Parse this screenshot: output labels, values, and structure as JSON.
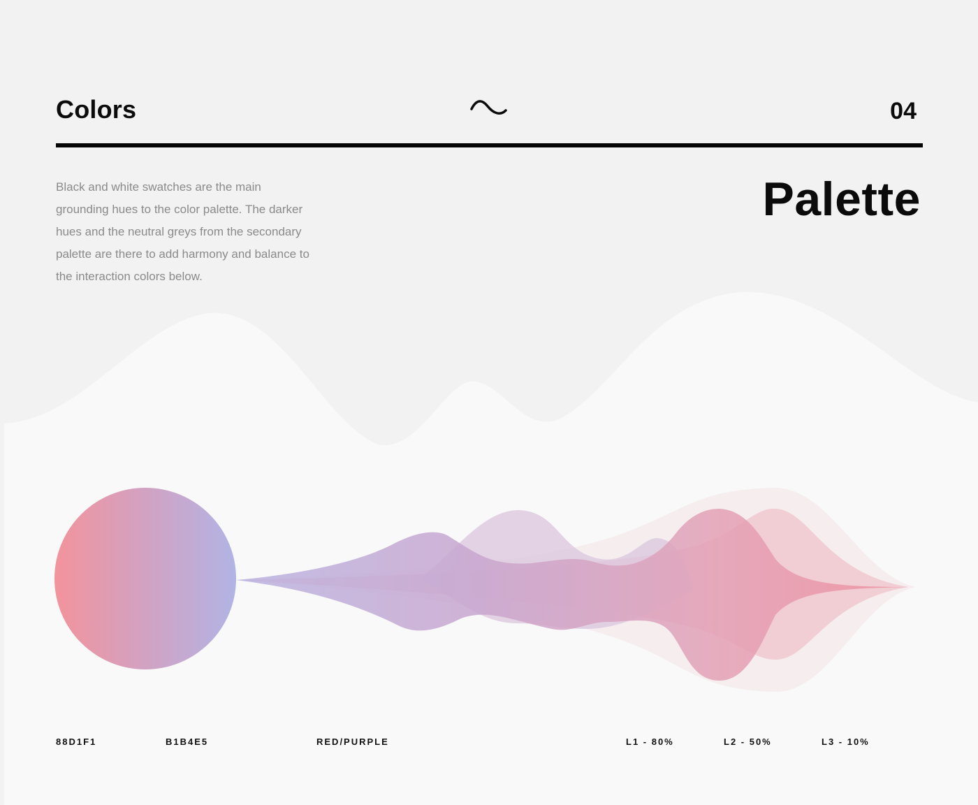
{
  "header": {
    "title": "Colors",
    "page_number": "04",
    "icon": "tilde-wave-icon"
  },
  "section": {
    "title": "Palette",
    "description": "Black and white swatches are the main grounding hues to the color palette. The darker hues and the neutral greys from the secondary palette are there to add harmony and balance to the interaction colors below."
  },
  "swatch": {
    "gradient_start": "#f3939c",
    "gradient_end": "#b1b4e5"
  },
  "labels": {
    "hex_1": "88D1F1",
    "hex_2": "B1B4E5",
    "blend": "RED/PURPLE",
    "level_1": "L1 - 80%",
    "level_2": "L2 - 50%",
    "level_3": "L3 - 10%"
  },
  "colors": {
    "background_top": "#f3f2f2",
    "background_bottom": "#f9f9f9",
    "purple": "#b9a6d6",
    "pink": "#e88a9a"
  }
}
